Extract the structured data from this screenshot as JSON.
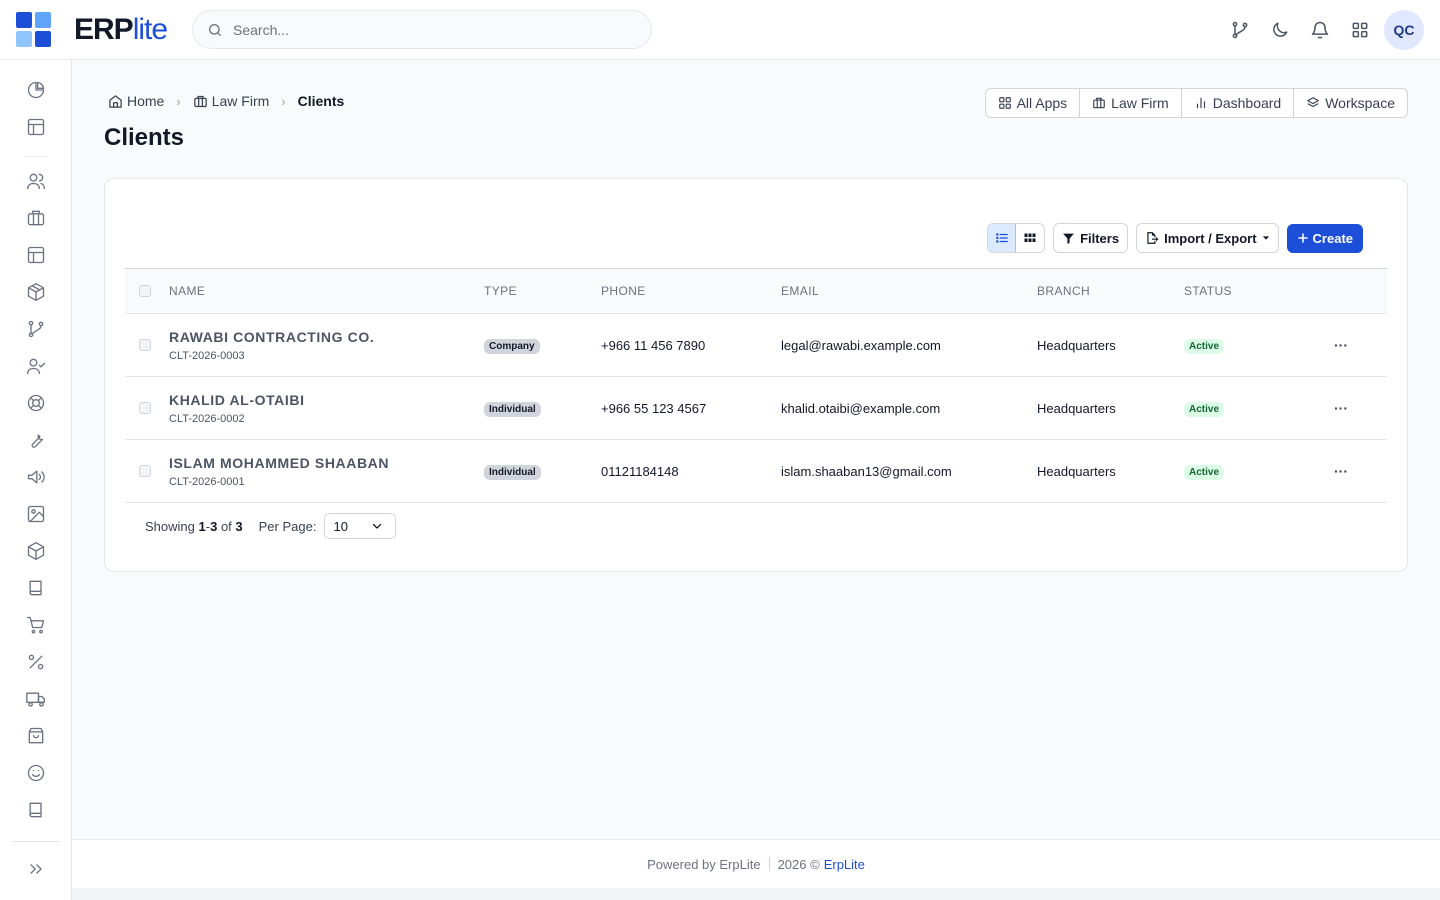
{
  "brand": {
    "name_main": "ERP",
    "name_accent": "lite",
    "colors": [
      "#1d4ed8",
      "#60a5fa",
      "#93c5fd",
      "#1d4ed8"
    ]
  },
  "header": {
    "search_placeholder": "Search...",
    "icons": [
      "git-branch-icon",
      "moon-icon",
      "bell-icon",
      "apps-grid-icon"
    ],
    "avatar_initials": "QC"
  },
  "sidebar": {
    "icons": [
      "pie-chart-icon",
      "layout-icon",
      "users-icon",
      "briefcase-icon",
      "layout-icon",
      "package-icon",
      "git-branch-icon",
      "user-check-icon",
      "lifebuoy-icon",
      "wrench-icon",
      "megaphone-icon",
      "image-icon",
      "box-icon",
      "book-icon",
      "cart-icon",
      "percent-icon",
      "truck-icon",
      "shopping-bag-icon",
      "smile-icon",
      "book-icon"
    ]
  },
  "breadcrumb": {
    "home": "Home",
    "section": "Law Firm",
    "current": "Clients",
    "separator": "›"
  },
  "page": {
    "title": "Clients"
  },
  "quick_nav": {
    "all_apps": "All Apps",
    "law_firm": "Law Firm",
    "dashboard": "Dashboard",
    "workspace": "Workspace"
  },
  "toolbar": {
    "filters": "Filters",
    "import_export": "Import / Export",
    "create": "Create"
  },
  "table": {
    "columns": {
      "name": "Name",
      "type": "Type",
      "phone": "Phone",
      "email": "Email",
      "branch": "Branch",
      "status": "Status"
    },
    "rows": [
      {
        "name": "RAWABI CONTRACTING CO.",
        "code": "CLT-2026-0003",
        "type": "Company",
        "phone": "+966 11 456 7890",
        "email": "legal@rawabi.example.com",
        "branch": "Headquarters",
        "status": "Active"
      },
      {
        "name": "KHALID AL-OTAIBI",
        "code": "CLT-2026-0002",
        "type": "Individual",
        "phone": "+966 55 123 4567",
        "email": "khalid.otaibi@example.com",
        "branch": "Headquarters",
        "status": "Active"
      },
      {
        "name": "ISLAM MOHAMMED SHAABAN",
        "code": "CLT-2026-0001",
        "type": "Individual",
        "phone": "01121184148",
        "email": "islam.shaaban13@gmail.com",
        "branch": "Headquarters",
        "status": "Active"
      }
    ],
    "row_action": "···"
  },
  "pager": {
    "showing_label": "Showing",
    "from": "1",
    "dash": "-",
    "to": "3",
    "of_label": "of",
    "total": "3",
    "per_page_label": "Per Page:",
    "per_page_value": "10"
  },
  "footer": {
    "powered_by": "Powered by ErpLite",
    "year_copy": "2026 ©",
    "link": "ErpLite"
  }
}
